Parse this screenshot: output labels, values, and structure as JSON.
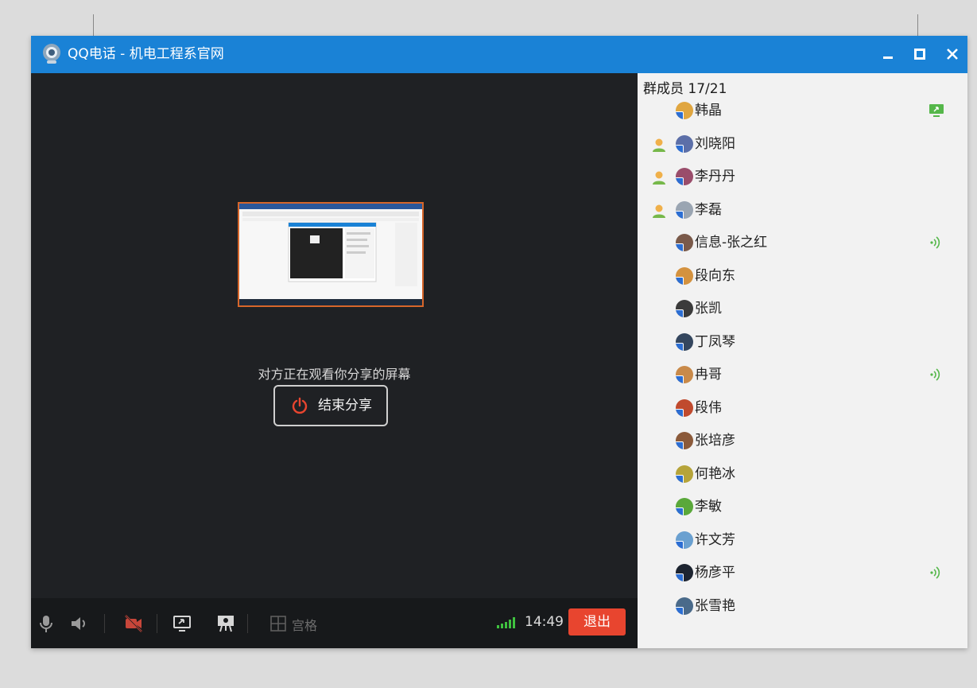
{
  "window": {
    "title": "QQ电话 - 机电工程系官网"
  },
  "share": {
    "status_text": "对方正在观看你分享的屏幕",
    "end_label": "结束分享"
  },
  "toolbar": {
    "grid_label": "宫格",
    "time": "14:49",
    "exit_label": "退出"
  },
  "sidebar": {
    "member_count": "群成员 17/21",
    "members": [
      {
        "name": "韩晶",
        "host": false,
        "status": "screen-share",
        "color": "#e0a640"
      },
      {
        "name": "刘晓阳",
        "host": true,
        "status": "",
        "color": "#5c6fa8"
      },
      {
        "name": "李丹丹",
        "host": true,
        "status": "",
        "color": "#9a4d6b"
      },
      {
        "name": "李磊",
        "host": true,
        "status": "",
        "color": "#9aa5b2"
      },
      {
        "name": "信息-张之红",
        "host": false,
        "status": "speaking",
        "color": "#7a5a4a"
      },
      {
        "name": "段向东",
        "host": false,
        "status": "",
        "color": "#d4923f"
      },
      {
        "name": "张凯",
        "host": false,
        "status": "",
        "color": "#3b3b3b"
      },
      {
        "name": "丁凤琴",
        "host": false,
        "status": "",
        "color": "#34465e"
      },
      {
        "name": "冉哥",
        "host": false,
        "status": "speaking",
        "color": "#c98a4a"
      },
      {
        "name": "段伟",
        "host": false,
        "status": "",
        "color": "#c04a2e"
      },
      {
        "name": "张培彦",
        "host": false,
        "status": "",
        "color": "#8b5a3a"
      },
      {
        "name": "何艳冰",
        "host": false,
        "status": "",
        "color": "#b6a43a"
      },
      {
        "name": "李敏",
        "host": false,
        "status": "",
        "color": "#5aa83a"
      },
      {
        "name": "许文芳",
        "host": false,
        "status": "",
        "color": "#6aa0d0"
      },
      {
        "name": "杨彦平",
        "host": false,
        "status": "speaking",
        "color": "#1d2430"
      },
      {
        "name": "张雪艳",
        "host": false,
        "status": "",
        "color": "#4a6a8a"
      }
    ]
  },
  "colors": {
    "titlebar": "#1a82d6",
    "exit": "#e8452f",
    "power": "#e8452f",
    "signal": "#3fc23f",
    "speaking": "#55b74a",
    "host": "#f0b04a"
  }
}
